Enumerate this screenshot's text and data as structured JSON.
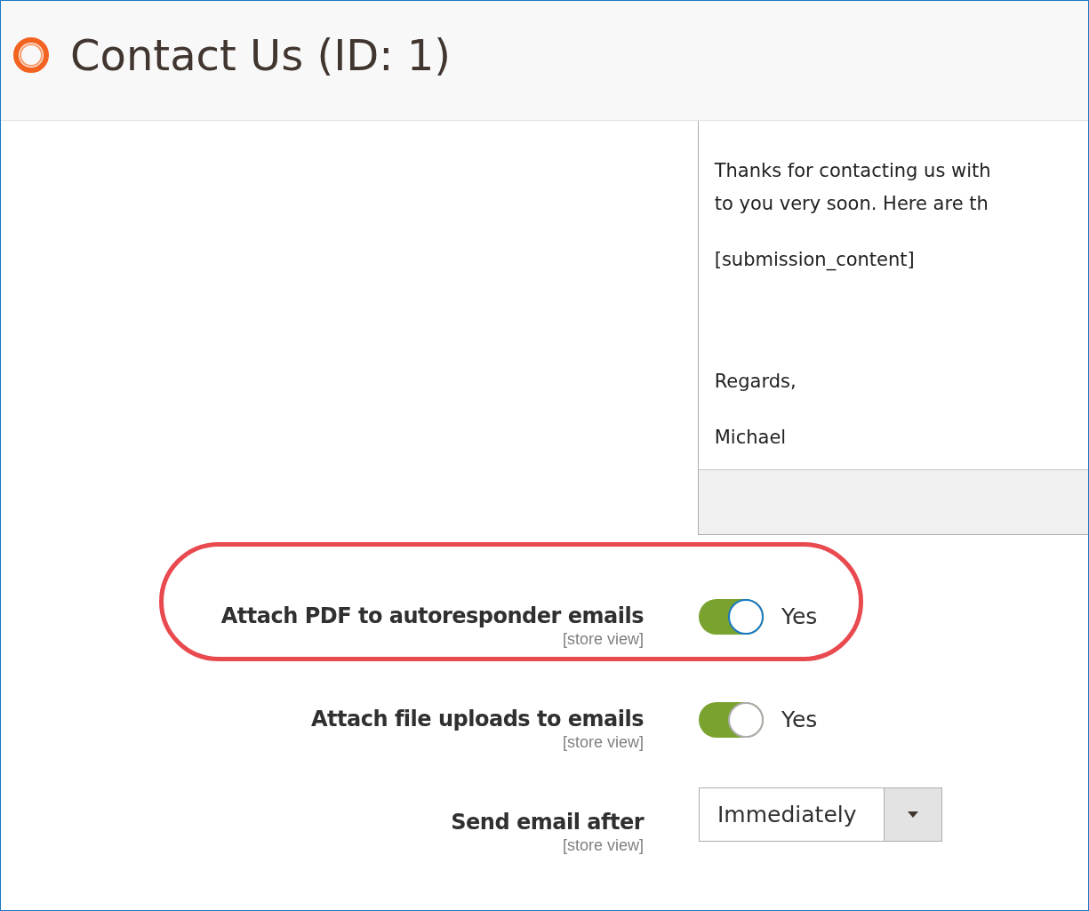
{
  "header": {
    "title": "Contact Us (ID: 1)"
  },
  "editor": {
    "paragraphs": [
      {
        "lines": [
          "Thanks for contacting us with",
          "to you very soon. Here are th"
        ]
      },
      {
        "lines": [
          "[submission_content]"
        ]
      },
      {
        "kind": "blank"
      },
      {
        "lines": [
          "Regards,"
        ]
      },
      {
        "lines": [
          "Michael"
        ]
      }
    ]
  },
  "fields": [
    {
      "kind": "toggle",
      "label": "Attach PDF to autoresponder emails",
      "scope": "[store view]",
      "on": true,
      "value": "Yes",
      "highlighted": true
    },
    {
      "kind": "toggle",
      "label": "Attach file uploads to emails",
      "scope": "[store view]",
      "on": true,
      "value": "Yes",
      "highlighted": false
    },
    {
      "kind": "select",
      "label": "Send email after",
      "scope": "[store view]",
      "value": "Immediately"
    }
  ]
}
